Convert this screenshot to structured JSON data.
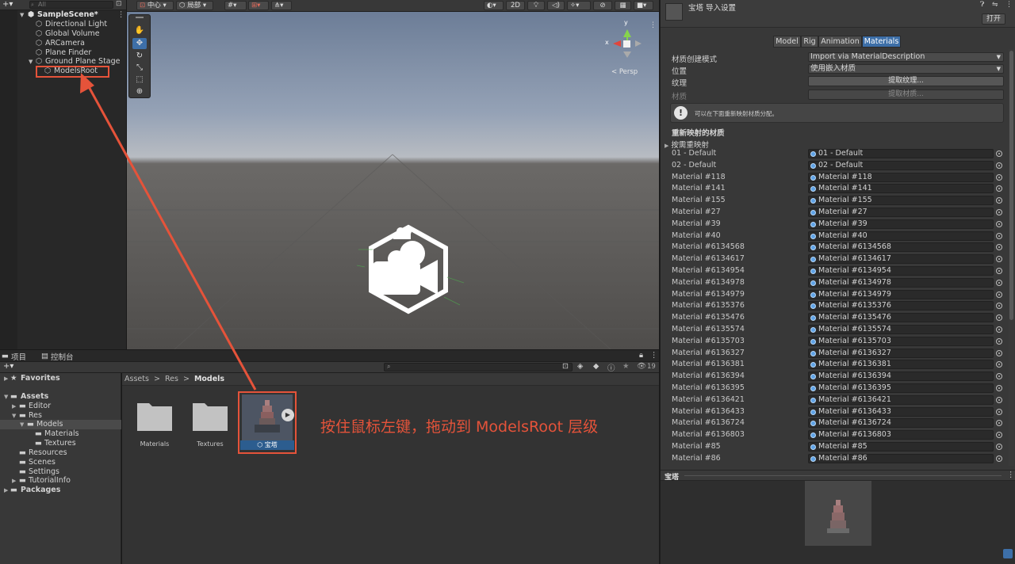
{
  "hierarchy": {
    "search_placeholder": "All",
    "scene_name": "SampleScene*",
    "items": [
      "Directional Light",
      "Global Volume",
      "ARCamera",
      "Plane Finder",
      "Ground Plane Stage",
      "ModelsRoot"
    ]
  },
  "scene_toolbar": {
    "pivot": "中心",
    "space": "局部",
    "mode_2d": "2D"
  },
  "scene": {
    "gizmo_y": "y",
    "gizmo_x": "x",
    "persp": "< Persp"
  },
  "project": {
    "tab_project": "项目",
    "tab_console": "控制台",
    "tree": {
      "favorites": "Favorites",
      "assets": "Assets",
      "editor": "Editor",
      "res": "Res",
      "models": "Models",
      "materials": "Materials",
      "textures": "Textures",
      "resources": "Resources",
      "scenes": "Scenes",
      "settings": "Settings",
      "tutorialinfo": "TutorialInfo",
      "packages": "Packages"
    },
    "breadcrumb": [
      "Assets",
      "Res",
      "Models"
    ],
    "hidden_count": "19",
    "folders": [
      "Materials",
      "Textures"
    ],
    "model_asset": "宝塔",
    "annotation": "按住鼠标左键，拖动到 ModelsRoot 层级"
  },
  "inspector": {
    "title": "宝塔 导入设置",
    "open_button": "打开",
    "tabs": [
      "Model",
      "Rig",
      "Animation",
      "Materials"
    ],
    "active_tab": "Materials",
    "material_creation_label": "材质创建模式",
    "material_creation_value": "Import via MaterialDescription",
    "location_label": "位置",
    "location_value": "使用嵌入材质",
    "textures_label": "纹理",
    "extract_textures": "提取纹理...",
    "materials_label": "材质",
    "extract_materials": "提取材质...",
    "help_text": "可以在下面重新映射材质分配。",
    "remapped_header": "重新映射的材质",
    "on_demand": "按需重映射",
    "materials": [
      "01 - Default",
      "02 - Default",
      "Material #118",
      "Material #141",
      "Material #155",
      "Material #27",
      "Material #39",
      "Material #40",
      "Material #6134568",
      "Material #6134617",
      "Material #6134954",
      "Material #6134978",
      "Material #6134979",
      "Material #6135376",
      "Material #6135476",
      "Material #6135574",
      "Material #6135703",
      "Material #6136327",
      "Material #6136381",
      "Material #6136394",
      "Material #6136395",
      "Material #6136421",
      "Material #6136433",
      "Material #6136724",
      "Material #6136803",
      "Material #85",
      "Material #86"
    ],
    "preview_title": "宝塔"
  },
  "colors": {
    "accent": "#3d6fa8",
    "annotation": "#e5533a"
  }
}
